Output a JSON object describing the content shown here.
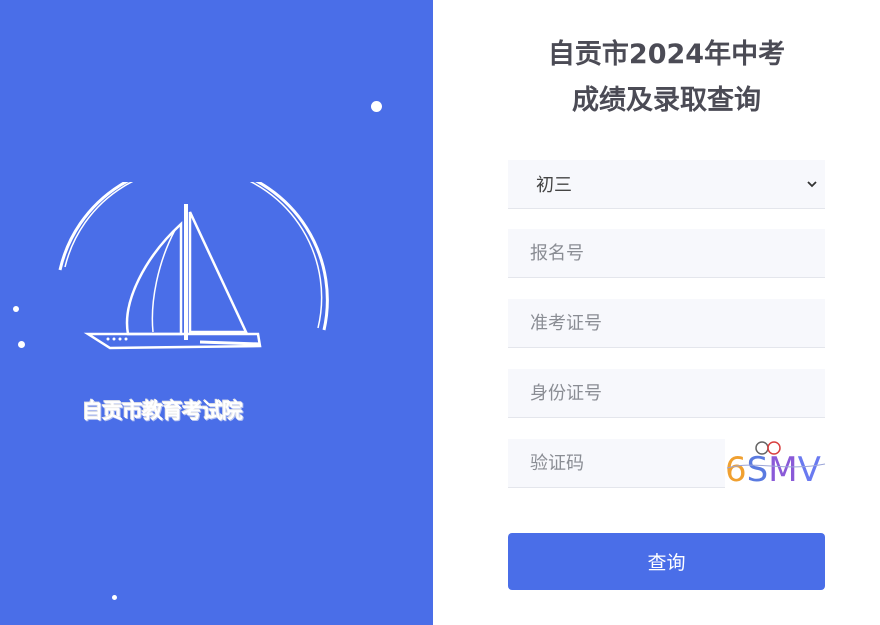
{
  "organization": {
    "name": "自贡市教育考试院"
  },
  "form": {
    "title_line1": "自贡市2024年中考",
    "title_line2": "成绩及录取查询",
    "grade_select": {
      "selected": "初三"
    },
    "registration_number": {
      "placeholder": "报名号"
    },
    "admission_ticket": {
      "placeholder": "准考证号"
    },
    "id_card": {
      "placeholder": "身份证号"
    },
    "captcha": {
      "placeholder": "验证码",
      "image_text": "6SMV"
    },
    "submit_label": "查询"
  },
  "colors": {
    "primary": "#4a6ee8",
    "title": "#4b4b55",
    "field_bg": "#f7f8fc"
  },
  "icons": {
    "select": "chevron-down-icon",
    "logo": "sailboat-logo"
  }
}
